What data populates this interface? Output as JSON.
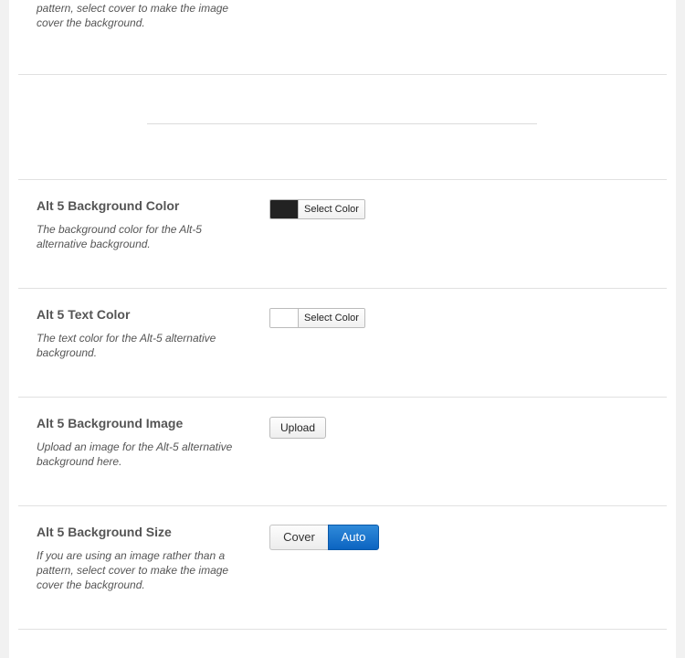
{
  "top_partial": {
    "description": "If you are using an image rather than a pattern, select cover to make the image cover the background."
  },
  "settings": {
    "bg_color": {
      "title": "Alt 5 Background Color",
      "description": "The background color for the Alt-5 alternative background.",
      "swatch_color": "#222222",
      "button_label": "Select Color"
    },
    "text_color": {
      "title": "Alt 5 Text Color",
      "description": "The text color for the Alt-5 alternative background.",
      "swatch_color": "#ffffff",
      "button_label": "Select Color"
    },
    "bg_image": {
      "title": "Alt 5 Background Image",
      "description": "Upload an image for the Alt-5 alternative background here.",
      "button_label": "Upload"
    },
    "bg_size": {
      "title": "Alt 5 Background Size",
      "description": "If you are using an image rather than a pattern, select cover to make the image cover the background.",
      "options": [
        "Cover",
        "Auto"
      ],
      "selected": "Auto"
    }
  },
  "colors": {
    "accent": "#0c64c1",
    "panel_background": "#ffffff",
    "page_background": "#f1f1f1"
  }
}
